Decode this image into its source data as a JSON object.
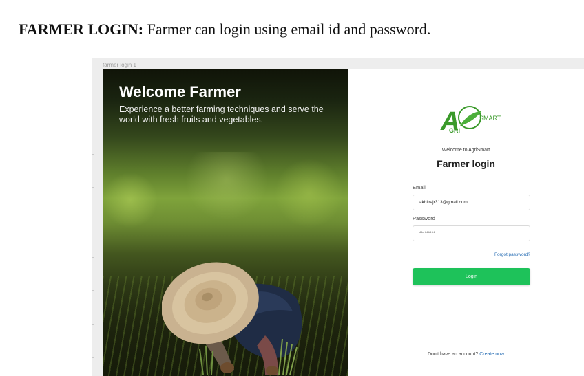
{
  "caption": {
    "bold": "FARMER LOGIN:",
    "text": " Farmer can login using email id and password."
  },
  "frame": {
    "label": "farmer login 1"
  },
  "hero": {
    "title": "Welcome Farmer",
    "subtitle": "Experience a better farming techniques and serve the world with fresh fruits and vegetables."
  },
  "logo": {
    "line1": "SMART",
    "line2": "GRI",
    "letter": "A",
    "accent": "#3a9a2a"
  },
  "login": {
    "welcome": "Welcome to AgriSmart",
    "heading": "Farmer login",
    "email_label": "Email",
    "email_value": "akhilrajr313@gmail.com",
    "password_label": "Password",
    "password_value": "*********",
    "forgot": "Forgot password?",
    "button": "Login",
    "signup_prompt": "Don't have an account?",
    "signup_link": "Create now",
    "button_color": "#1ec25a"
  }
}
